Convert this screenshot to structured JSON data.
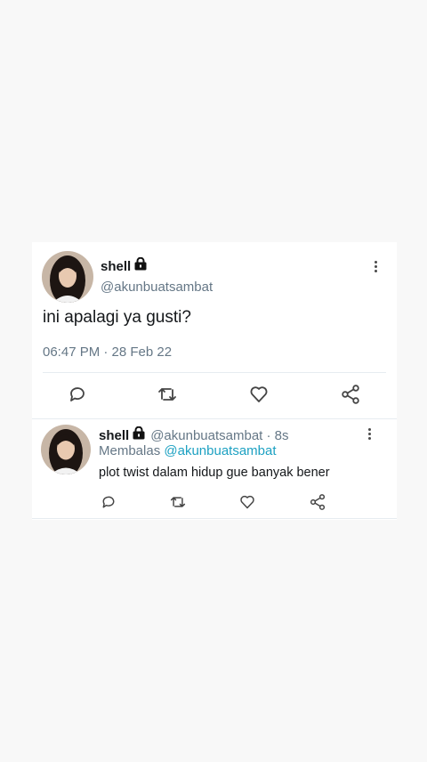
{
  "tweet": {
    "display_name": "shell",
    "handle": "@akunbuatsambat",
    "text": "ini apalagi ya gusti?",
    "timestamp": "06:47 PM · 28 Feb 22",
    "actions": [
      "reply-icon",
      "retweet-icon",
      "like-icon",
      "share-icon"
    ]
  },
  "reply": {
    "display_name": "shell",
    "handle_time": "@akunbuatsambat · 8s",
    "replying_prefix": "Membalas",
    "replying_to": "@akunbuatsambat",
    "text": "plot twist dalam hidup gue banyak bener"
  },
  "colors": {
    "link": "#1da1c2",
    "secondary_text": "#657786",
    "background": "#f8f8f8",
    "card": "#ffffff"
  }
}
